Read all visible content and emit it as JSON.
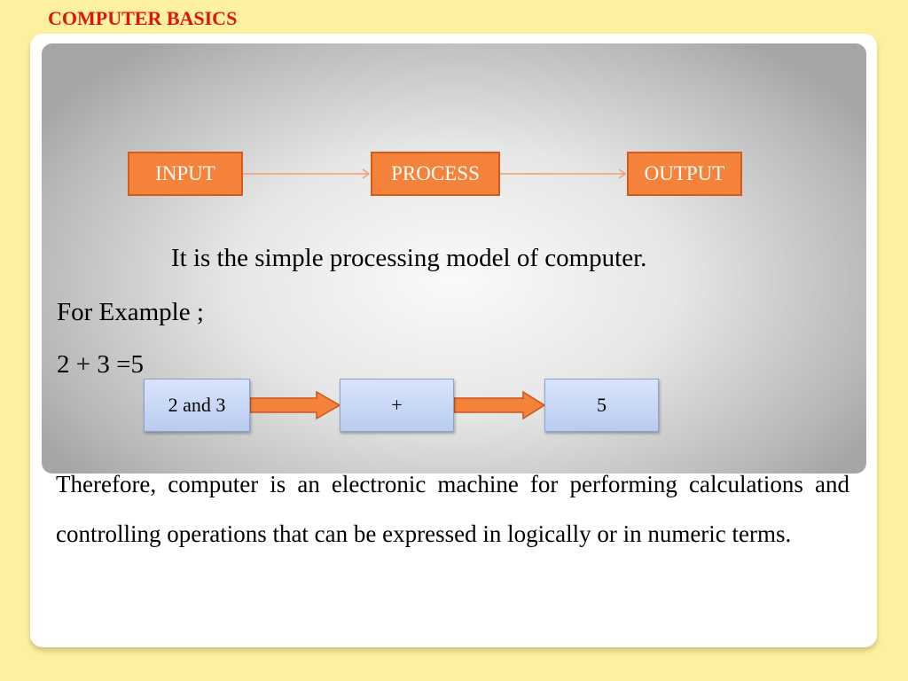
{
  "header": {
    "title": "COMPUTER BASICS"
  },
  "colors": {
    "title": "#e0140f",
    "background": "#fdf19f",
    "orange_box": "#f5823a",
    "blue_box": "#c8d8f6"
  },
  "model": {
    "boxes": [
      "INPUT",
      "PROCESS",
      "OUTPUT"
    ],
    "caption": "It is the simple processing model of computer."
  },
  "example": {
    "label": "For Example ;",
    "equation": "2 + 3 =5",
    "boxes": [
      "2 and 3",
      "+",
      "5"
    ]
  },
  "paragraph": "Therefore, computer is an electronic machine for performing calculations and controlling operations that can be expressed in logically or in numeric terms."
}
